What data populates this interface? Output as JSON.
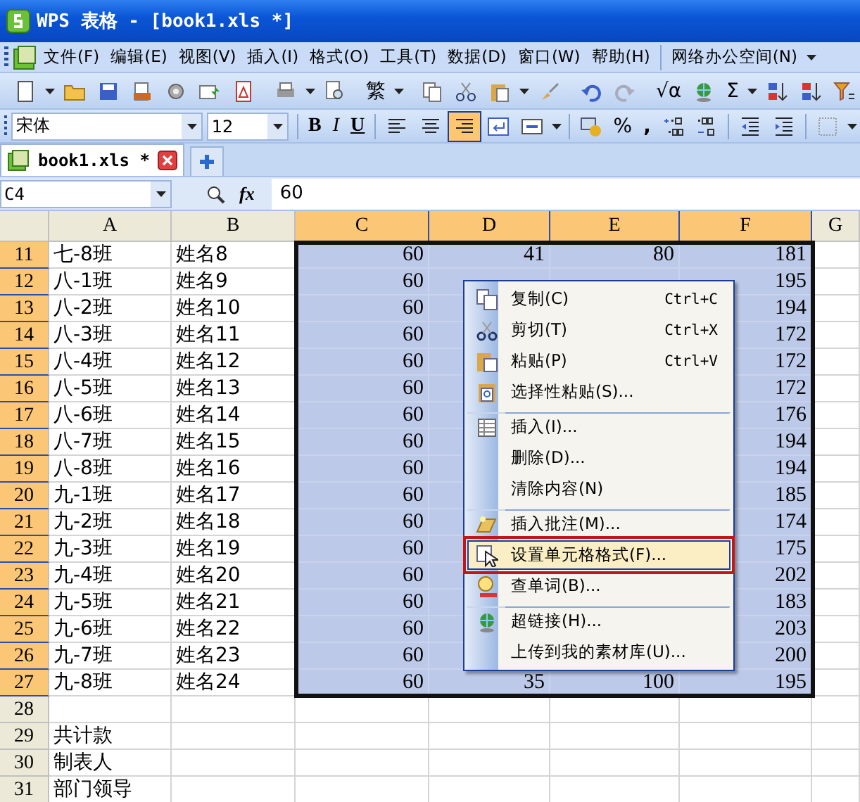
{
  "window": {
    "title": "WPS 表格 - [book1.xls *]"
  },
  "menu_bar": {
    "items": [
      "文件(F)",
      "编辑(E)",
      "视图(V)",
      "插入(I)",
      "格式(O)",
      "工具(T)",
      "数据(D)",
      "窗口(W)",
      "帮助(H)"
    ],
    "extra": "网络办公空间(N)"
  },
  "toolbar": {
    "items": [
      {
        "kind": "icon"
      },
      {
        "kind": "caret"
      },
      {
        "kind": "icon"
      },
      {
        "kind": "icon"
      },
      {
        "kind": "icon"
      },
      {
        "kind": "icon"
      },
      {
        "kind": "icon"
      },
      {
        "kind": "icon"
      },
      {
        "kind": "sep"
      },
      {
        "kind": "icon"
      },
      {
        "kind": "caret"
      },
      {
        "kind": "icon"
      },
      {
        "kind": "sep"
      },
      {
        "kind": "text",
        "label": "繁"
      },
      {
        "kind": "caret"
      },
      {
        "kind": "sep"
      },
      {
        "kind": "icon"
      },
      {
        "kind": "icon"
      },
      {
        "kind": "icon"
      },
      {
        "kind": "caret"
      },
      {
        "kind": "icon"
      },
      {
        "kind": "sep"
      },
      {
        "kind": "icon"
      },
      {
        "kind": "icon"
      },
      {
        "kind": "sep"
      },
      {
        "kind": "text",
        "label": "√α"
      },
      {
        "kind": "icon"
      },
      {
        "kind": "text",
        "label": "Σ"
      },
      {
        "kind": "caret"
      },
      {
        "kind": "icon"
      },
      {
        "kind": "icon"
      },
      {
        "kind": "icon"
      },
      {
        "kind": "caret"
      }
    ]
  },
  "format_bar": {
    "font": "宋体",
    "size": "12",
    "styles": [
      "B",
      "I",
      "U"
    ],
    "align": [
      {
        "selected": false
      },
      {
        "selected": false
      },
      {
        "selected": true
      }
    ],
    "percent": "%",
    "comma": ","
  },
  "tabs": [
    {
      "label": "book1.xls *",
      "selected": true
    }
  ],
  "formula_bar": {
    "cell": "C4",
    "fx": "fx",
    "value": "60"
  },
  "sheet": {
    "columns": [
      {
        "label": "A",
        "selected": false
      },
      {
        "label": "B",
        "selected": false
      },
      {
        "label": "C",
        "selected": true
      },
      {
        "label": "D",
        "selected": true
      },
      {
        "label": "E",
        "selected": true
      },
      {
        "label": "F",
        "selected": true
      },
      {
        "label": "G",
        "selected": false
      }
    ],
    "rows": [
      {
        "num": "11",
        "selected": true,
        "cells": [
          "七-8班",
          "姓名8",
          "60",
          "41",
          "80",
          "181"
        ]
      },
      {
        "num": "12",
        "selected": true,
        "cells": [
          "八-1班",
          "姓名9",
          "60",
          "",
          "",
          "195"
        ]
      },
      {
        "num": "13",
        "selected": true,
        "cells": [
          "八-2班",
          "姓名10",
          "60",
          "",
          "",
          "194"
        ]
      },
      {
        "num": "14",
        "selected": true,
        "cells": [
          "八-3班",
          "姓名11",
          "60",
          "",
          "",
          "172"
        ]
      },
      {
        "num": "15",
        "selected": true,
        "cells": [
          "八-4班",
          "姓名12",
          "60",
          "",
          "",
          "172"
        ]
      },
      {
        "num": "16",
        "selected": true,
        "cells": [
          "八-5班",
          "姓名13",
          "60",
          "",
          "",
          "172"
        ]
      },
      {
        "num": "17",
        "selected": true,
        "cells": [
          "八-6班",
          "姓名14",
          "60",
          "",
          "",
          "176"
        ]
      },
      {
        "num": "18",
        "selected": true,
        "cells": [
          "八-7班",
          "姓名15",
          "60",
          "",
          "",
          "194"
        ]
      },
      {
        "num": "19",
        "selected": true,
        "cells": [
          "八-8班",
          "姓名16",
          "60",
          "",
          "",
          "194"
        ]
      },
      {
        "num": "20",
        "selected": true,
        "cells": [
          "九-1班",
          "姓名17",
          "60",
          "",
          "",
          "185"
        ]
      },
      {
        "num": "21",
        "selected": true,
        "cells": [
          "九-2班",
          "姓名18",
          "60",
          "",
          "",
          "174"
        ]
      },
      {
        "num": "22",
        "selected": true,
        "cells": [
          "九-3班",
          "姓名19",
          "60",
          "",
          "",
          "175"
        ]
      },
      {
        "num": "23",
        "selected": true,
        "cells": [
          "九-4班",
          "姓名20",
          "60",
          "",
          "",
          "202"
        ]
      },
      {
        "num": "24",
        "selected": true,
        "cells": [
          "九-5班",
          "姓名21",
          "60",
          "",
          "",
          "183"
        ]
      },
      {
        "num": "25",
        "selected": true,
        "cells": [
          "九-6班",
          "姓名22",
          "60",
          "",
          "",
          "203"
        ]
      },
      {
        "num": "26",
        "selected": true,
        "cells": [
          "九-7班",
          "姓名23",
          "60",
          "",
          "",
          "200"
        ]
      },
      {
        "num": "27",
        "selected": true,
        "cells": [
          "九-8班",
          "姓名24",
          "60",
          "35",
          "100",
          "195"
        ]
      },
      {
        "num": "28",
        "selected": false,
        "cells": [
          "",
          "",
          "",
          "",
          "",
          ""
        ]
      },
      {
        "num": "29",
        "selected": false,
        "cells": [
          "共计款",
          "",
          "",
          "",
          "",
          ""
        ]
      },
      {
        "num": "30",
        "selected": false,
        "cells": [
          "制表人",
          "",
          "",
          "",
          "",
          ""
        ]
      },
      {
        "num": "31",
        "selected": false,
        "cells": [
          "部门领导",
          "",
          "",
          "",
          "",
          ""
        ]
      }
    ]
  },
  "context_menu": {
    "items": [
      {
        "label": "复制(C)",
        "shortcut": "Ctrl+C",
        "separator_before": false,
        "selected": false
      },
      {
        "label": "剪切(T)",
        "shortcut": "Ctrl+X",
        "separator_before": false,
        "selected": false
      },
      {
        "label": "粘贴(P)",
        "shortcut": "Ctrl+V",
        "separator_before": false,
        "selected": false
      },
      {
        "label": "选择性粘贴(S)...",
        "separator_before": false,
        "selected": false
      },
      {
        "label": "插入(I)...",
        "separator_before": true,
        "selected": false
      },
      {
        "label": "删除(D)...",
        "separator_before": false,
        "selected": false
      },
      {
        "label": "清除内容(N)",
        "separator_before": false,
        "selected": false
      },
      {
        "label": "插入批注(M)...",
        "separator_before": true,
        "selected": false
      },
      {
        "label": "设置单元格格式(F)...",
        "separator_before": false,
        "selected": true
      },
      {
        "label": "查单词(B)...",
        "separator_before": false,
        "selected": false
      },
      {
        "label": "超链接(H)...",
        "separator_before": true,
        "selected": false
      },
      {
        "label": "上传到我的素材库(U)...",
        "separator_before": false,
        "selected": false
      }
    ]
  }
}
